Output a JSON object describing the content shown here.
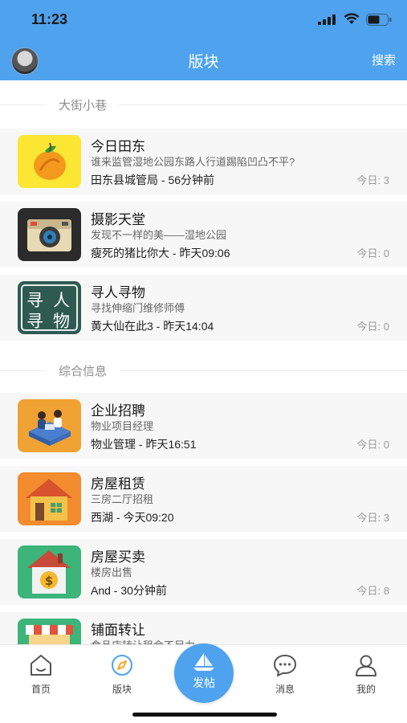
{
  "status_bar": {
    "time": "11:23"
  },
  "nav": {
    "title": "版块",
    "search_label": "搜索"
  },
  "sections": [
    {
      "title": "大街小巷",
      "items": [
        {
          "name": "今日田东",
          "desc": "谁来监管湿地公园东路人行道踢陷凹凸不平?",
          "meta": "田东县城管局 - 56分钟前",
          "count": "今日:  3",
          "icon": "mango-icon"
        },
        {
          "name": "摄影天堂",
          "desc": "发现不一样的美——湿地公园",
          "meta": "瘦死的猪比你大 - 昨天09:06",
          "count": "今日:  0",
          "icon": "camera-icon"
        },
        {
          "name": "寻人寻物",
          "desc": "寻找伸缩门维修师傅",
          "meta": "黄大仙在此3 - 昨天14:04",
          "count": "今日:  0",
          "icon": "seek-icon",
          "icon_text": [
            "寻",
            "人",
            "寻",
            "物"
          ]
        }
      ]
    },
    {
      "title": "综合信息",
      "items": [
        {
          "name": "企业招聘",
          "desc": "物业项目经理",
          "meta": "物业管理 - 昨天16:51",
          "count": "今日:  0",
          "icon": "office-icon"
        },
        {
          "name": "房屋租赁",
          "desc": "三房二厅招租",
          "meta": "西湖 - 今天09:20",
          "count": "今日:  3",
          "icon": "house-icon"
        },
        {
          "name": "房屋买卖",
          "desc": "楼房出售",
          "meta": "And - 30分钟前",
          "count": "今日:  8",
          "icon": "house-dollar-icon"
        },
        {
          "name": "铺面转让",
          "desc": "食品店转让租金不足力",
          "meta": "",
          "count": "",
          "icon": "shop-icon"
        }
      ]
    }
  ],
  "tabbar": {
    "home": "首页",
    "forums": "版块",
    "post": "发帖",
    "messages": "消息",
    "mine": "我的"
  },
  "colors": {
    "accent": "#4ea2ee",
    "item_bg": "#f7f7f7"
  }
}
